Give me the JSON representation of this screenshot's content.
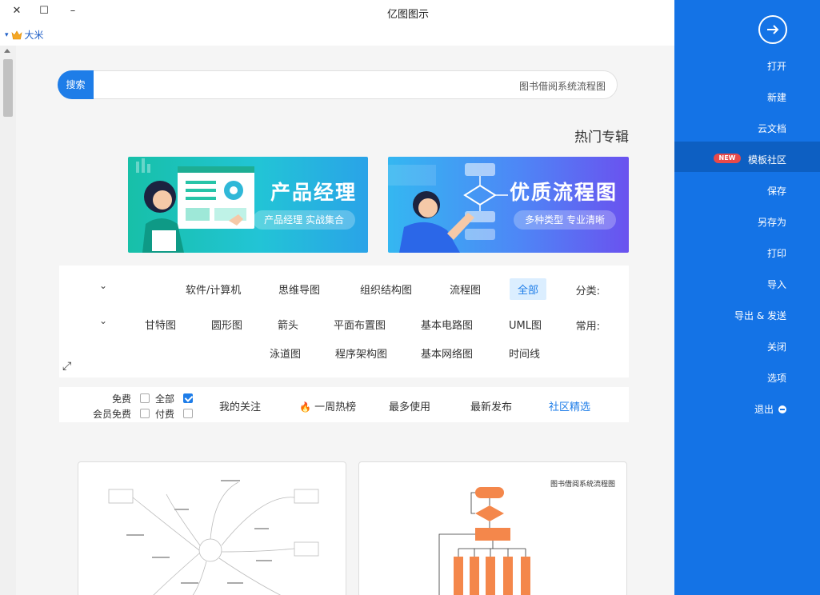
{
  "window": {
    "title": "亿图图示",
    "close_glyph": "✕",
    "maximize_glyph": "☐",
    "minimize_glyph": "–"
  },
  "user": {
    "name": "大米",
    "icon": "crown-icon",
    "dropdown_glyph": "▾"
  },
  "search": {
    "button_label": "搜索",
    "placeholder": "图书借阅系统流程图"
  },
  "hot_topics": {
    "title": "热门专辑",
    "banners": [
      {
        "title": "产品经理",
        "subtitle": "产品经理 实战集合"
      },
      {
        "title": "优质流程图",
        "subtitle": "多种类型 专业清晰"
      }
    ]
  },
  "filters": {
    "category_label": "分类:",
    "categories": [
      "全部",
      "流程图",
      "组织结构图",
      "思维导图",
      "软件/计算机"
    ],
    "common_label": "常用:",
    "common_row1": [
      "UML图",
      "基本电路图",
      "平面布置图",
      "箭头",
      "圆形图",
      "甘特图"
    ],
    "common_row2": [
      "时间线",
      "基本网络图",
      "程序架构图",
      "泳道图"
    ],
    "expand_glyph": "⤢",
    "chevron_glyph": "⌄"
  },
  "tabs": {
    "items": [
      "社区精选",
      "最新发布",
      "最多使用",
      "一周热榜",
      "我的关注"
    ],
    "fire_glyph": "🔥",
    "checks": [
      {
        "label": "全部",
        "checked": true
      },
      {
        "label": "免费",
        "checked": false
      },
      {
        "label": "付费",
        "checked": false
      },
      {
        "label": "会员免费",
        "checked": false
      }
    ]
  },
  "cards": [
    {
      "title": ""
    },
    {
      "title": "图书借阅系统流程图"
    }
  ],
  "sidebar": {
    "back_glyph": "→",
    "items": [
      "打开",
      "新建",
      "云文档",
      "模板社区",
      "保存",
      "另存为",
      "打印",
      "导入",
      "导出 & 发送",
      "关闭",
      "选项",
      "退出"
    ],
    "new_badge": "NEW"
  },
  "colors": {
    "accent": "#1e7de8",
    "sidebar_bg": "#1473e6",
    "sidebar_active": "#0d5fc2",
    "orange": "#f4874b"
  }
}
